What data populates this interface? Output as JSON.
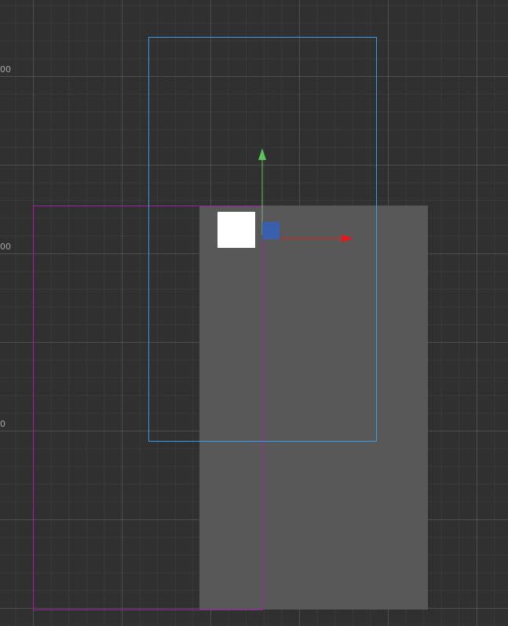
{
  "ruler": {
    "labels": [
      "00",
      "00",
      "0"
    ]
  },
  "colors": {
    "background": "#303030",
    "canvas": "#585858",
    "camera_bounds": "#3c9be6",
    "selection_bounds": "#a020a8",
    "x_axis": "#e61717",
    "y_axis": "#5bc75b",
    "center_handle": "#3a5fae",
    "sprite": "#ffffff"
  },
  "gizmo": {
    "x_axis_icon": "arrow-right-icon",
    "y_axis_icon": "arrow-up-icon",
    "center_icon": "square-handle-icon"
  }
}
